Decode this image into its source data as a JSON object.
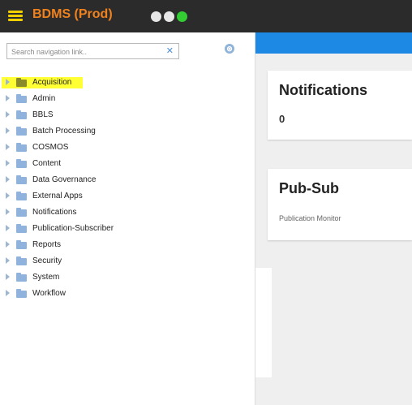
{
  "header": {
    "app_title": "BDMS (Prod)",
    "menu_icon": "hamburger-icon",
    "window_dots": [
      "#e6e6e6",
      "#e6e6e6",
      "#33cc33"
    ],
    "accent_color": "#f0821e"
  },
  "sidebar": {
    "search": {
      "placeholder": "Search navigation link..",
      "value": "",
      "clear_icon": "close-circle-icon"
    },
    "settings_icon": "gear-icon",
    "items": [
      {
        "label": "Acquisition",
        "selected": true
      },
      {
        "label": "Admin"
      },
      {
        "label": "BBLS"
      },
      {
        "label": "Batch Processing"
      },
      {
        "label": "COSMOS"
      },
      {
        "label": "Content"
      },
      {
        "label": "Data Governance"
      },
      {
        "label": "External Apps"
      },
      {
        "label": "Notifications"
      },
      {
        "label": "Publication-Subscriber"
      },
      {
        "label": "Reports"
      },
      {
        "label": "Security"
      },
      {
        "label": "System"
      },
      {
        "label": "Workflow"
      }
    ]
  },
  "main": {
    "band_color": "#1e88e5",
    "cards": [
      {
        "title": "Notifications",
        "value": "0"
      },
      {
        "title": "Pub-Sub",
        "subtitle": "Publication Monitor"
      }
    ]
  }
}
